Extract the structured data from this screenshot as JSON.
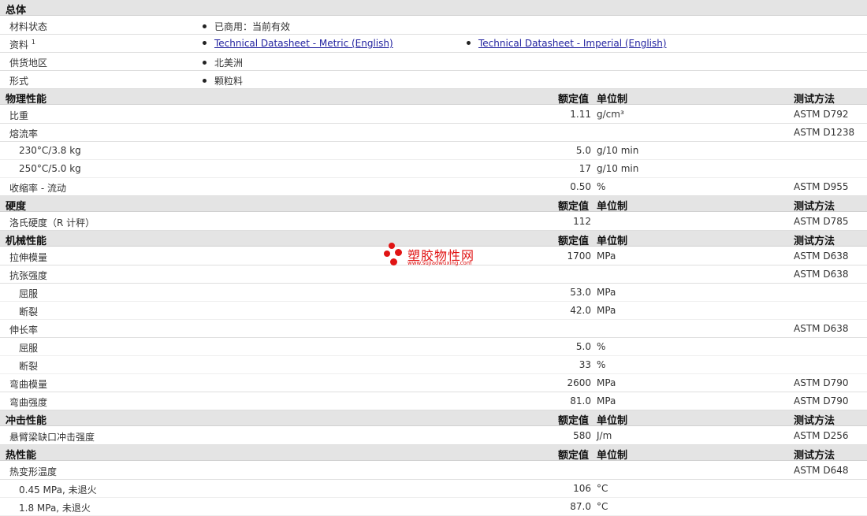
{
  "general": {
    "title": "总体",
    "rows": [
      {
        "label": "材料状态",
        "items": [
          "已商用：当前有效"
        ]
      },
      {
        "label": "资料",
        "sup": "1",
        "links": [
          "Technical Datasheet - Metric (English)",
          "Technical Datasheet - Imperial (English)"
        ]
      },
      {
        "label": "供货地区",
        "items": [
          "北美洲"
        ]
      },
      {
        "label": "形式",
        "items": [
          "颗粒料"
        ]
      }
    ]
  },
  "columns": {
    "value": "额定值",
    "unit": "单位制",
    "test": "测试方法"
  },
  "sections": [
    {
      "title": "物理性能",
      "rows": [
        {
          "label": "比重",
          "value": "1.11",
          "unit": "g/cm³",
          "test": "ASTM D792"
        },
        {
          "label": "熔流率",
          "value": "",
          "unit": "",
          "test": "ASTM D1238"
        },
        {
          "label": "230°C/3.8 kg",
          "value": "5.0",
          "unit": "g/10 min",
          "test": ""
        },
        {
          "label": "250°C/5.0 kg",
          "value": "17",
          "unit": "g/10 min",
          "test": ""
        },
        {
          "label": "收缩率 - 流动",
          "value": "0.50",
          "unit": "%",
          "test": "ASTM D955"
        }
      ]
    },
    {
      "title": "硬度",
      "rows": [
        {
          "label": "洛氏硬度（R 计秤）",
          "value": "112",
          "unit": "",
          "test": "ASTM D785"
        }
      ]
    },
    {
      "title": "机械性能",
      "rows": [
        {
          "label": "拉伸模量",
          "value": "1700",
          "unit": "MPa",
          "test": "ASTM D638"
        },
        {
          "label": "抗张强度",
          "value": "",
          "unit": "",
          "test": "ASTM D638"
        },
        {
          "label": "屈服",
          "value": "53.0",
          "unit": "MPa",
          "test": ""
        },
        {
          "label": "断裂",
          "value": "42.0",
          "unit": "MPa",
          "test": ""
        },
        {
          "label": "伸长率",
          "value": "",
          "unit": "",
          "test": "ASTM D638"
        },
        {
          "label": "屈服",
          "value": "5.0",
          "unit": "%",
          "test": ""
        },
        {
          "label": "断裂",
          "value": "33",
          "unit": "%",
          "test": ""
        },
        {
          "label": "弯曲模量",
          "value": "2600",
          "unit": "MPa",
          "test": "ASTM D790"
        },
        {
          "label": "弯曲强度",
          "value": "81.0",
          "unit": "MPa",
          "test": "ASTM D790"
        }
      ]
    },
    {
      "title": "冲击性能",
      "rows": [
        {
          "label": "悬臂梁缺口冲击强度",
          "value": "580",
          "unit": "J/m",
          "test": "ASTM D256"
        }
      ]
    },
    {
      "title": "热性能",
      "rows": [
        {
          "label": "热变形温度",
          "value": "",
          "unit": "",
          "test": "ASTM D648"
        },
        {
          "label": "0.45 MPa, 未退火",
          "value": "106",
          "unit": "°C",
          "test": ""
        },
        {
          "label": "1.8 MPa, 未退火",
          "value": "87.0",
          "unit": "°C",
          "test": ""
        }
      ]
    }
  ],
  "watermark": {
    "title": "塑胶物性网",
    "url": "www.sujiaowuxing.com"
  },
  "colors": {
    "header_bg": "#e4e4e4",
    "link": "#2323a0",
    "watermark": "#e01414"
  }
}
